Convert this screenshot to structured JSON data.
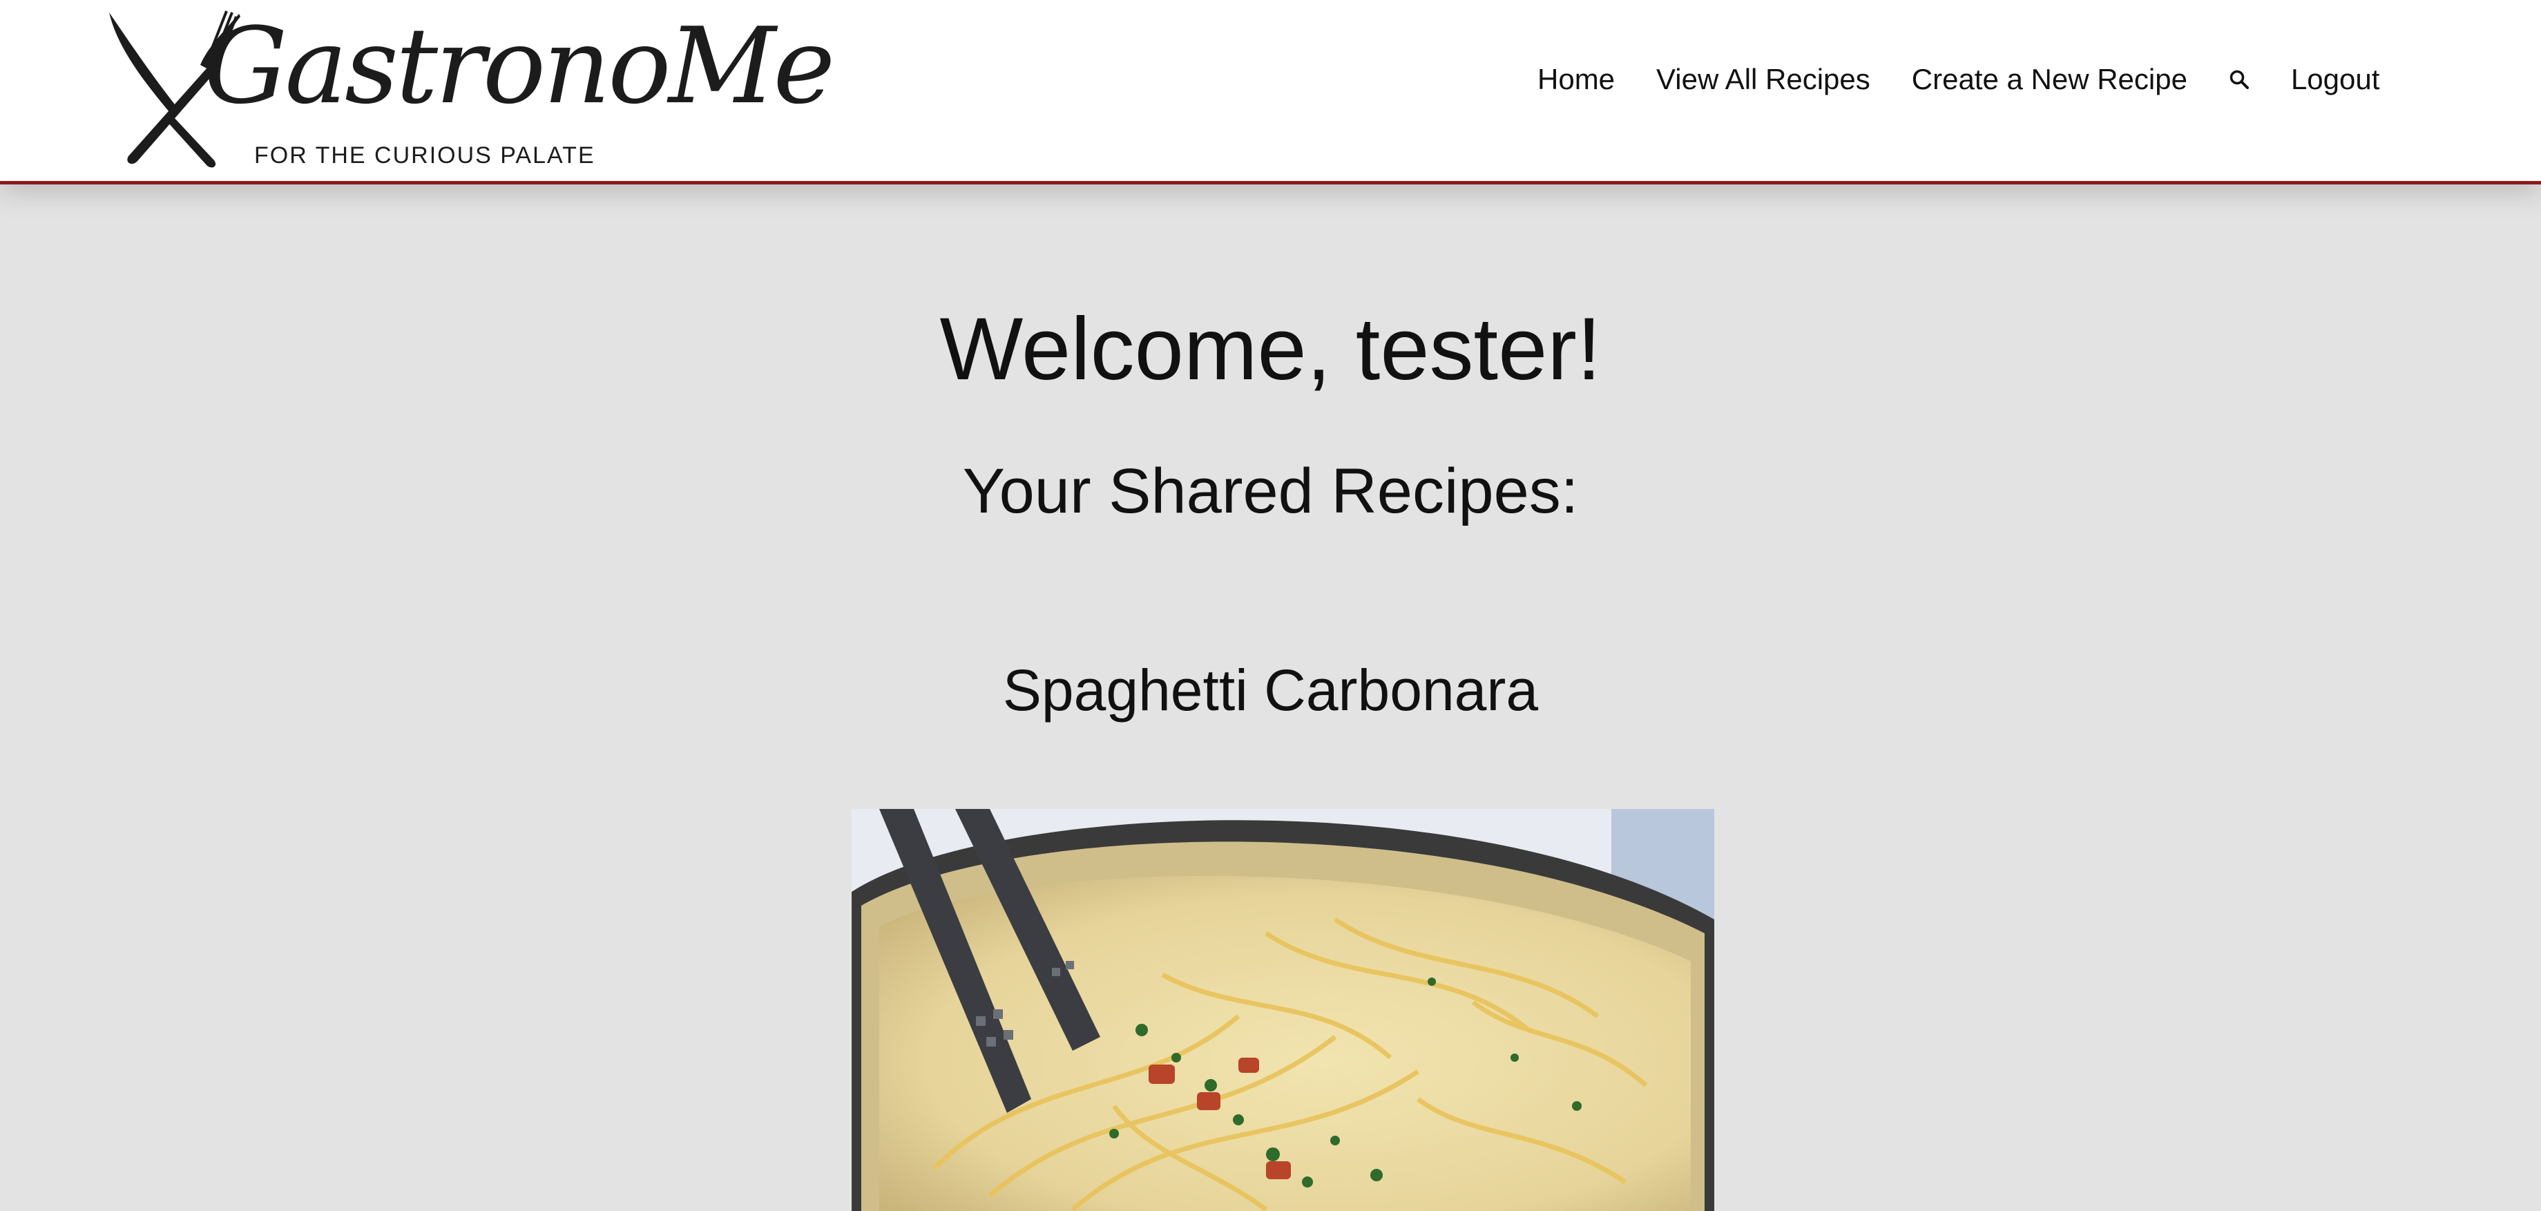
{
  "logo": {
    "name": "GastronoMe",
    "tagline": "FOR THE CURIOUS PALATE",
    "icon": "fork-knife-crossed-icon"
  },
  "nav": {
    "home": "Home",
    "view_all": "View All Recipes",
    "create": "Create a New Recipe",
    "search_icon": "search-icon",
    "logout": "Logout"
  },
  "main": {
    "welcome": "Welcome, tester!",
    "shared_heading": "Your Shared Recipes:",
    "recipes": [
      {
        "title": "Spaghetti Carbonara"
      }
    ]
  },
  "colors": {
    "header_bg": "#ffffff",
    "header_border": "#8b1a1a",
    "page_bg": "#e3e3e3",
    "text": "#111111"
  }
}
